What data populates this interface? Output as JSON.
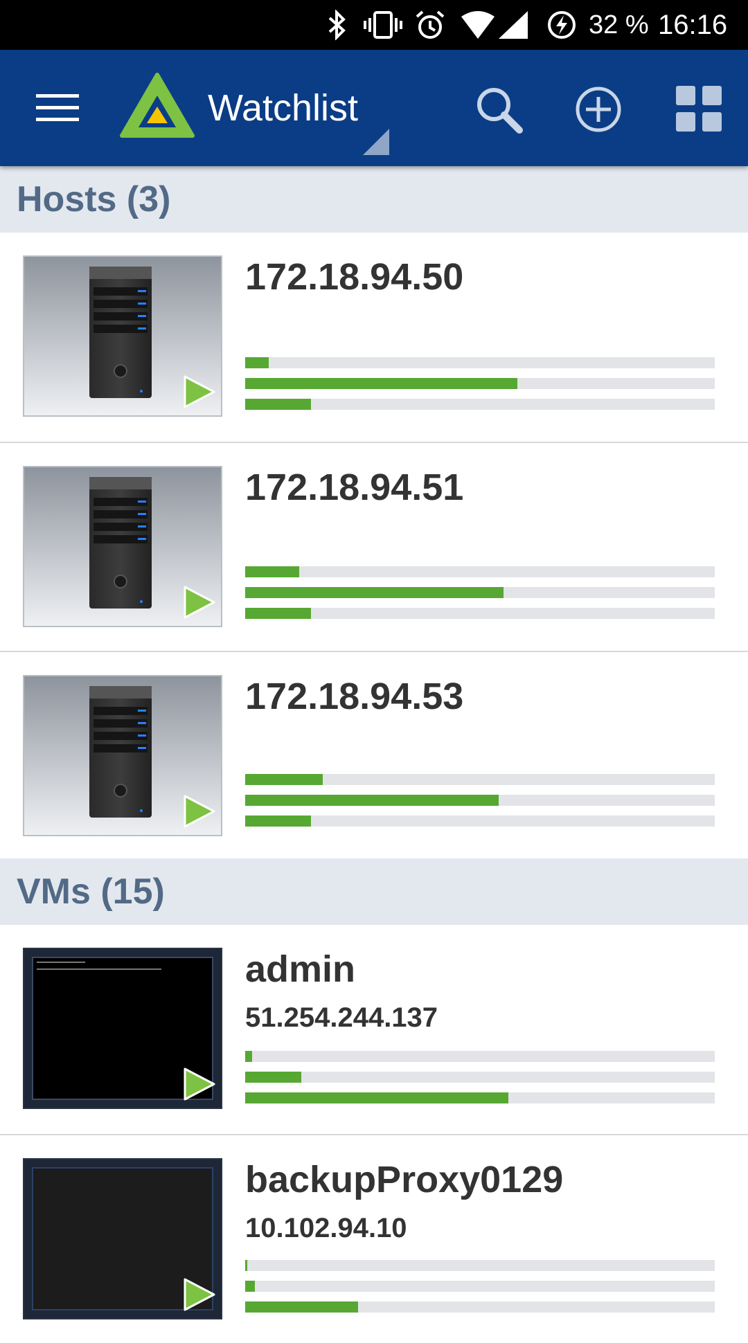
{
  "status_bar": {
    "battery": "32 %",
    "time": "16:16",
    "icons": [
      "bluetooth-icon",
      "vibrate-icon",
      "alarm-icon",
      "wifi-icon",
      "signal-icon",
      "battery-charging-icon"
    ]
  },
  "app_bar": {
    "title": "Watchlist",
    "icons": [
      "menu-icon",
      "app-logo",
      "search-icon",
      "add-icon",
      "grid-view-icon"
    ]
  },
  "colors": {
    "app_bar": "#0b3d86",
    "section_bg": "#e3e8ef",
    "section_text": "#526a86",
    "bar_fill": "#56a832",
    "bar_track": "#e2e4e8"
  },
  "sections": [
    {
      "title": "Hosts (3)",
      "items": [
        {
          "name": "172.18.94.50",
          "ip": "",
          "type": "host",
          "usage": [
            0.05,
            0.58,
            0.14
          ]
        },
        {
          "name": "172.18.94.51",
          "ip": "",
          "type": "host",
          "usage": [
            0.115,
            0.55,
            0.14
          ]
        },
        {
          "name": "172.18.94.53",
          "ip": "",
          "type": "host",
          "usage": [
            0.165,
            0.54,
            0.14
          ]
        }
      ]
    },
    {
      "title": "VMs (15)",
      "items": [
        {
          "name": "admin",
          "ip": "51.254.244.137",
          "type": "vm-console",
          "usage": [
            0.015,
            0.12,
            0.56
          ]
        },
        {
          "name": "backupProxy0129",
          "ip": "10.102.94.10",
          "type": "vm-blank",
          "usage": [
            0.005,
            0.02,
            0.24
          ]
        }
      ]
    }
  ]
}
